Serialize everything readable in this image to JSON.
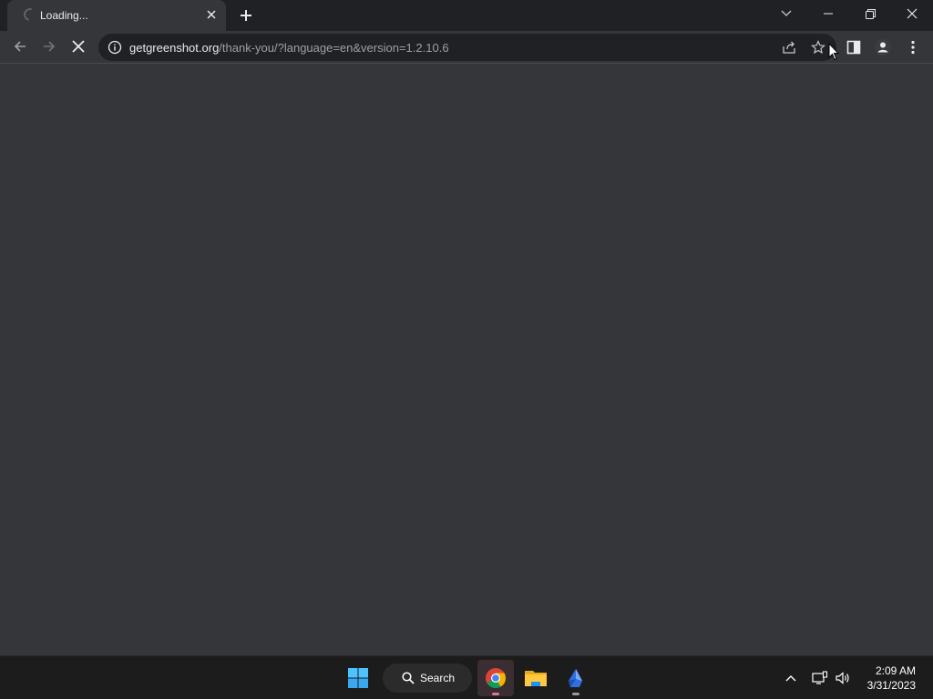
{
  "browser": {
    "tab": {
      "title": "Loading...",
      "state": "loading"
    },
    "address_bar": {
      "host": "getgreenshot.org",
      "path": "/thank-you/?language=en&version=1.2.10.6"
    }
  },
  "taskbar": {
    "search_label": "Search",
    "clock": {
      "time": "2:09 AM",
      "date": "3/31/2023"
    },
    "apps": [
      "windows-start",
      "chrome",
      "file-explorer",
      "app-blue"
    ]
  },
  "colors": {
    "titlebar": "#202124",
    "toolbar": "#35363a",
    "omnibox": "#202124",
    "taskbar": "#1c1c1c"
  }
}
